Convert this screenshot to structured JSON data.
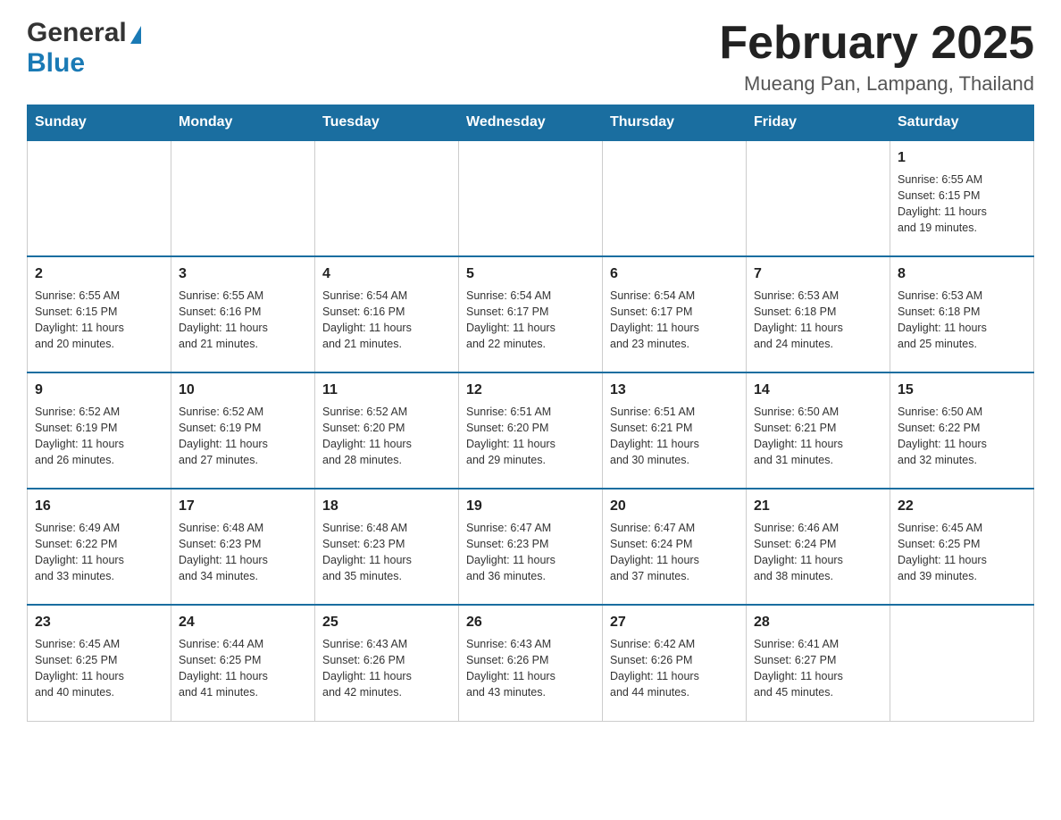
{
  "header": {
    "logo_general": "General",
    "logo_blue": "Blue",
    "month_title": "February 2025",
    "location": "Mueang Pan, Lampang, Thailand"
  },
  "weekdays": [
    "Sunday",
    "Monday",
    "Tuesday",
    "Wednesday",
    "Thursday",
    "Friday",
    "Saturday"
  ],
  "weeks": [
    {
      "days": [
        {
          "number": "",
          "info": ""
        },
        {
          "number": "",
          "info": ""
        },
        {
          "number": "",
          "info": ""
        },
        {
          "number": "",
          "info": ""
        },
        {
          "number": "",
          "info": ""
        },
        {
          "number": "",
          "info": ""
        },
        {
          "number": "1",
          "info": "Sunrise: 6:55 AM\nSunset: 6:15 PM\nDaylight: 11 hours\nand 19 minutes."
        }
      ]
    },
    {
      "days": [
        {
          "number": "2",
          "info": "Sunrise: 6:55 AM\nSunset: 6:15 PM\nDaylight: 11 hours\nand 20 minutes."
        },
        {
          "number": "3",
          "info": "Sunrise: 6:55 AM\nSunset: 6:16 PM\nDaylight: 11 hours\nand 21 minutes."
        },
        {
          "number": "4",
          "info": "Sunrise: 6:54 AM\nSunset: 6:16 PM\nDaylight: 11 hours\nand 21 minutes."
        },
        {
          "number": "5",
          "info": "Sunrise: 6:54 AM\nSunset: 6:17 PM\nDaylight: 11 hours\nand 22 minutes."
        },
        {
          "number": "6",
          "info": "Sunrise: 6:54 AM\nSunset: 6:17 PM\nDaylight: 11 hours\nand 23 minutes."
        },
        {
          "number": "7",
          "info": "Sunrise: 6:53 AM\nSunset: 6:18 PM\nDaylight: 11 hours\nand 24 minutes."
        },
        {
          "number": "8",
          "info": "Sunrise: 6:53 AM\nSunset: 6:18 PM\nDaylight: 11 hours\nand 25 minutes."
        }
      ]
    },
    {
      "days": [
        {
          "number": "9",
          "info": "Sunrise: 6:52 AM\nSunset: 6:19 PM\nDaylight: 11 hours\nand 26 minutes."
        },
        {
          "number": "10",
          "info": "Sunrise: 6:52 AM\nSunset: 6:19 PM\nDaylight: 11 hours\nand 27 minutes."
        },
        {
          "number": "11",
          "info": "Sunrise: 6:52 AM\nSunset: 6:20 PM\nDaylight: 11 hours\nand 28 minutes."
        },
        {
          "number": "12",
          "info": "Sunrise: 6:51 AM\nSunset: 6:20 PM\nDaylight: 11 hours\nand 29 minutes."
        },
        {
          "number": "13",
          "info": "Sunrise: 6:51 AM\nSunset: 6:21 PM\nDaylight: 11 hours\nand 30 minutes."
        },
        {
          "number": "14",
          "info": "Sunrise: 6:50 AM\nSunset: 6:21 PM\nDaylight: 11 hours\nand 31 minutes."
        },
        {
          "number": "15",
          "info": "Sunrise: 6:50 AM\nSunset: 6:22 PM\nDaylight: 11 hours\nand 32 minutes."
        }
      ]
    },
    {
      "days": [
        {
          "number": "16",
          "info": "Sunrise: 6:49 AM\nSunset: 6:22 PM\nDaylight: 11 hours\nand 33 minutes."
        },
        {
          "number": "17",
          "info": "Sunrise: 6:48 AM\nSunset: 6:23 PM\nDaylight: 11 hours\nand 34 minutes."
        },
        {
          "number": "18",
          "info": "Sunrise: 6:48 AM\nSunset: 6:23 PM\nDaylight: 11 hours\nand 35 minutes."
        },
        {
          "number": "19",
          "info": "Sunrise: 6:47 AM\nSunset: 6:23 PM\nDaylight: 11 hours\nand 36 minutes."
        },
        {
          "number": "20",
          "info": "Sunrise: 6:47 AM\nSunset: 6:24 PM\nDaylight: 11 hours\nand 37 minutes."
        },
        {
          "number": "21",
          "info": "Sunrise: 6:46 AM\nSunset: 6:24 PM\nDaylight: 11 hours\nand 38 minutes."
        },
        {
          "number": "22",
          "info": "Sunrise: 6:45 AM\nSunset: 6:25 PM\nDaylight: 11 hours\nand 39 minutes."
        }
      ]
    },
    {
      "days": [
        {
          "number": "23",
          "info": "Sunrise: 6:45 AM\nSunset: 6:25 PM\nDaylight: 11 hours\nand 40 minutes."
        },
        {
          "number": "24",
          "info": "Sunrise: 6:44 AM\nSunset: 6:25 PM\nDaylight: 11 hours\nand 41 minutes."
        },
        {
          "number": "25",
          "info": "Sunrise: 6:43 AM\nSunset: 6:26 PM\nDaylight: 11 hours\nand 42 minutes."
        },
        {
          "number": "26",
          "info": "Sunrise: 6:43 AM\nSunset: 6:26 PM\nDaylight: 11 hours\nand 43 minutes."
        },
        {
          "number": "27",
          "info": "Sunrise: 6:42 AM\nSunset: 6:26 PM\nDaylight: 11 hours\nand 44 minutes."
        },
        {
          "number": "28",
          "info": "Sunrise: 6:41 AM\nSunset: 6:27 PM\nDaylight: 11 hours\nand 45 minutes."
        },
        {
          "number": "",
          "info": ""
        }
      ]
    }
  ]
}
